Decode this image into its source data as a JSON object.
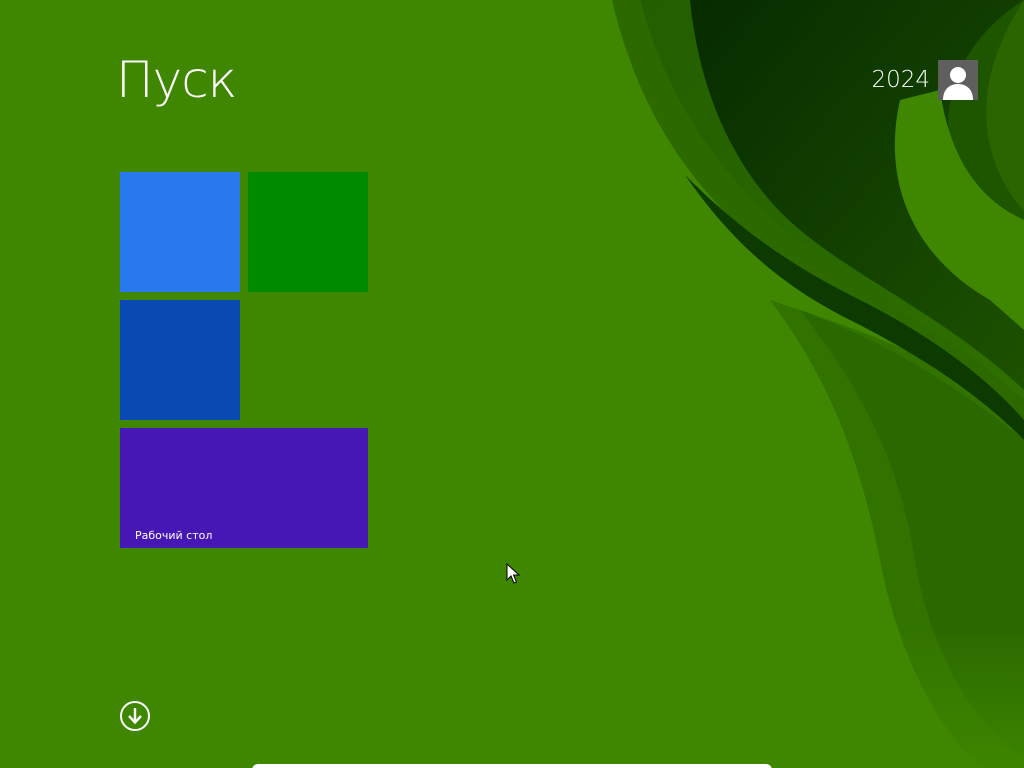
{
  "start_screen": {
    "title": "Пуск",
    "background_color": "#3f8700"
  },
  "user": {
    "name": "2024",
    "avatar_icon": "user-silhouette-icon",
    "avatar_background": "#5f5f5f"
  },
  "tiles": [
    {
      "color": "#2878ee",
      "label": ""
    },
    {
      "color": "#008a00",
      "label": ""
    },
    {
      "color": "#094ab2",
      "label": ""
    },
    {
      "color": "#4617b4",
      "label": "Рабочий стол"
    }
  ],
  "all_apps": {
    "icon": "arrow-down-circle-icon"
  }
}
